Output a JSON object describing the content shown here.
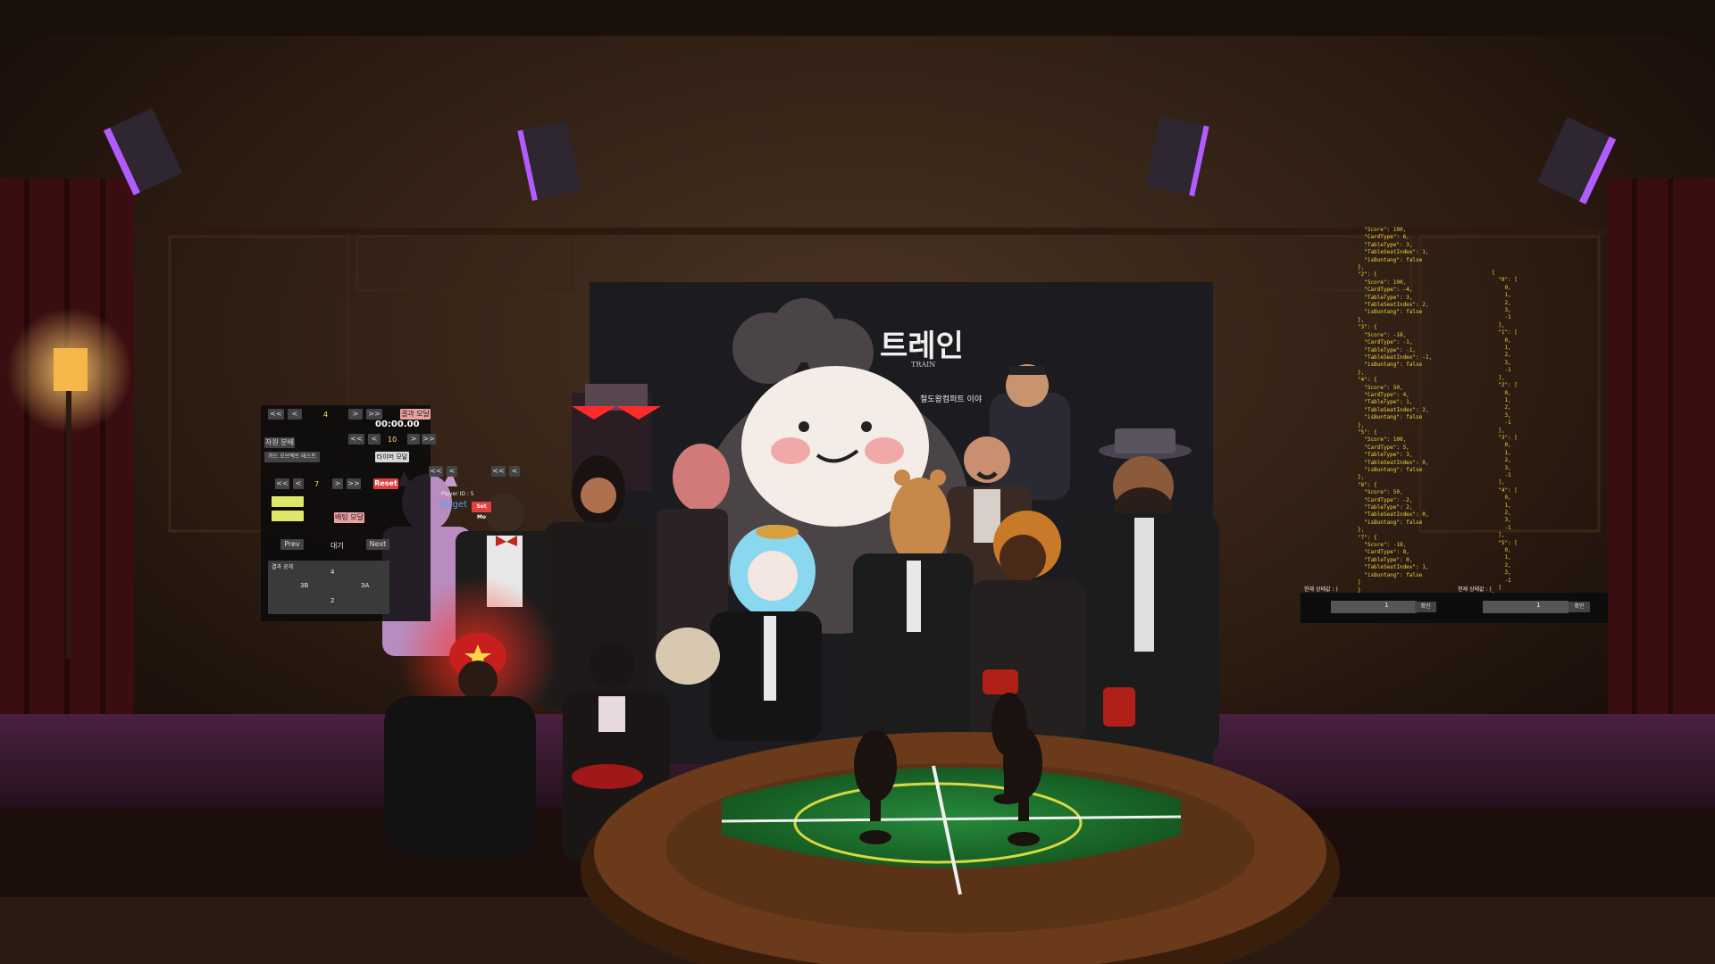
{
  "scene": {
    "type": "VR social world - poker room group photo",
    "colors": {
      "felt": "#1e6b2e",
      "table_wood": "#5a3216",
      "stage": "#3a1a2e",
      "json_text": "#f0d440",
      "purple_light": "#b25cff"
    }
  },
  "poster": {
    "title": "트레인",
    "subtitle": "TRAIN",
    "tagline": "철도왕컴퍼트 이야"
  },
  "control_panel": {
    "row1": {
      "first": "<<",
      "prev": "<",
      "value": "4",
      "next": ">",
      "last": ">>",
      "action": "결과 모달"
    },
    "timer": "00:00.00",
    "row2": {
      "first": "<<",
      "prev": "<",
      "value": "10",
      "next": ">",
      "last": ">>"
    },
    "left_buttons": [
      "자원 분배",
      "카드 오브젝트 테스트"
    ],
    "mid_button": "타이머 모달",
    "row3": {
      "first": "<<",
      "prev": "<",
      "value": "7",
      "next": ">",
      "last": ">>",
      "reset": "Reset"
    },
    "player_info": "Player ID : 5",
    "target_label": "Target",
    "set_button": "Set Mo",
    "modal_button": "배팅 모달",
    "nav": {
      "prev": "Prev",
      "wait": "대기",
      "next": "Next"
    },
    "result_title": "결과 공개",
    "result_values": [
      "4",
      "3B",
      "3A",
      "2"
    ],
    "extra": {
      "first": "<<",
      "prev": "<",
      "first2": "<<",
      "prev2": "<"
    }
  },
  "json_panel": {
    "left_lines": [
      "  \"Score\": 100,",
      "  \"CardType\": 6,",
      "  \"TableType\": 3,",
      "  \"TableSeatIndex\": 1,",
      "  \"isBuntang\": false",
      "},",
      "\"2\": {",
      "  \"Score\": 100,",
      "  \"CardType\": -4,",
      "  \"TableType\": 3,",
      "  \"TableSeatIndex\": 2,",
      "  \"isBuntang\": false",
      "},",
      "\"3\": {",
      "  \"Score\": -18,",
      "  \"CardType\": -1,",
      "  \"TableType\": -1,",
      "  \"TableSeatIndex\": -1,",
      "  \"isBuntang\": false",
      "},",
      "\"4\": {",
      "  \"Score\": 50,",
      "  \"CardType\": 4,",
      "  \"TableType\": 1,",
      "  \"TableSeatIndex\": 2,",
      "  \"isBuntang\": false",
      "},",
      "\"5\": {",
      "  \"Score\": 100,",
      "  \"CardType\": 5,",
      "  \"TableType\": 3,",
      "  \"TableSeatIndex\": 0,",
      "  \"isBuntang\": false",
      "},",
      "\"6\": {",
      "  \"Score\": 50,",
      "  \"CardType\": -2,",
      "  \"TableType\": 2,",
      "  \"TableSeatIndex\": 0,",
      "  \"isBuntang\": false",
      "},",
      "\"7\": {",
      "  \"Score\": -18,",
      "  \"CardType\": 8,",
      "  \"TableType\": 0,",
      "  \"TableSeatIndex\": 1,",
      "  \"isBuntang\": false",
      "}",
      "}"
    ],
    "right_lines": [
      "{",
      "  \"0\": [",
      "    0,",
      "    1,",
      "    2,",
      "    3,",
      "    -1",
      "  ],",
      "  \"1\": [",
      "    0,",
      "    1,",
      "    2,",
      "    3,",
      "    -1",
      "  ],",
      "  \"2\": [",
      "    0,",
      "    1,",
      "    2,",
      "    3,",
      "    -1",
      "  ],",
      "  \"3\": [",
      "    0,",
      "    1,",
      "    2,",
      "    3,",
      "    -1",
      "  ],",
      "  \"4\": [",
      "    0,",
      "    1,",
      "    2,",
      "    3,",
      "    -1",
      "  ],",
      "  \"5\": [",
      "    0,",
      "    1,",
      "    2,",
      "    3,",
      "    -1",
      "  ]",
      "}"
    ],
    "input_left": {
      "label": "현재 상태값 : )",
      "value": "1",
      "button": "확인"
    },
    "input_right": {
      "label": "현재 상태값 : )",
      "value": "1",
      "button": "확인"
    }
  }
}
